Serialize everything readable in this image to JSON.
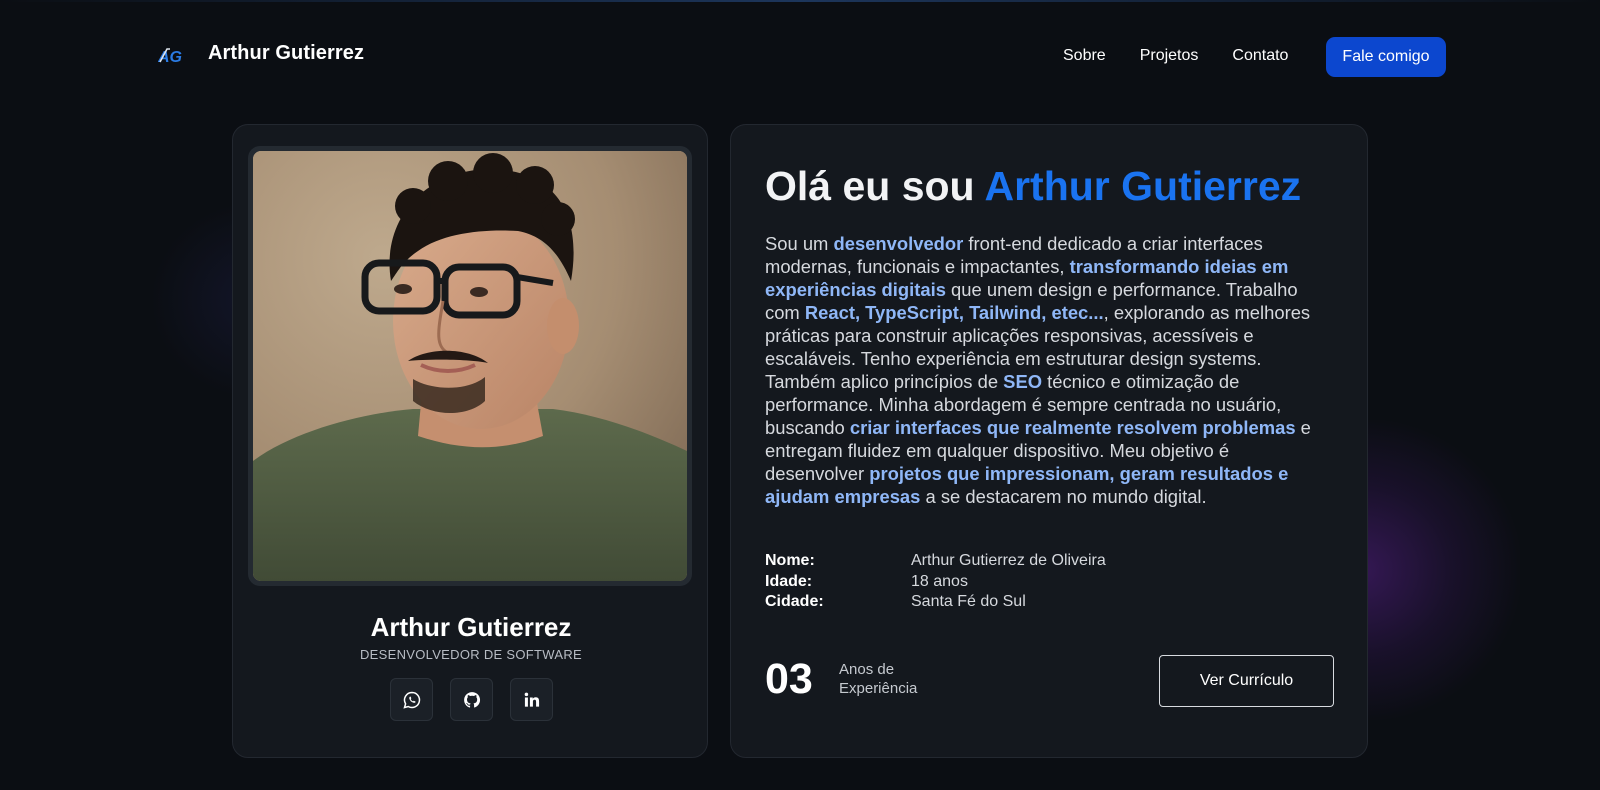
{
  "header": {
    "logo_text": "AG",
    "brand_name": "Arthur Gutierrez",
    "nav": [
      "Sobre",
      "Projetos",
      "Contato"
    ],
    "cta_label": "Fale comigo"
  },
  "profile": {
    "name": "Arthur Gutierrez",
    "role": "DESENVOLVEDOR DE SOFTWARE",
    "socials": [
      {
        "icon": "whatsapp-icon"
      },
      {
        "icon": "github-icon"
      },
      {
        "icon": "linkedin-icon"
      }
    ]
  },
  "about": {
    "greeting": "Olá eu sou ",
    "greeting_name": "Arthur Gutierrez",
    "bio": [
      {
        "t": "Sou um ",
        "b": false
      },
      {
        "t": "desenvolvedor",
        "b": true
      },
      {
        "t": " front-end dedicado a criar interfaces modernas, funcionais e impactantes, ",
        "b": false
      },
      {
        "t": "transformando ideias em experiências digitais",
        "b": true
      },
      {
        "t": " que unem design e performance. Trabalho com ",
        "b": false
      },
      {
        "t": "React, TypeScript, Tailwind, etec...",
        "b": true
      },
      {
        "t": ", explorando as melhores práticas para construir aplicações responsivas, acessíveis e escaláveis. Tenho experiência em estruturar design systems. Também aplico princípios de ",
        "b": false
      },
      {
        "t": "SEO",
        "b": true
      },
      {
        "t": " técnico e otimização de performance. Minha abordagem é sempre centrada no usuário, buscando ",
        "b": false
      },
      {
        "t": "criar interfaces que realmente resolvem problemas",
        "b": true
      },
      {
        "t": " e entregam fluidez em qualquer dispositivo. Meu objetivo é desenvolver ",
        "b": false
      },
      {
        "t": "projetos que impressionam, geram resultados e ajudam empresas",
        "b": true
      },
      {
        "t": " a se destacarem no mundo digital.",
        "b": false
      }
    ],
    "facts": [
      {
        "label": "Nome:",
        "value": "Arthur Gutierrez de Oliveira"
      },
      {
        "label": "Idade:",
        "value": "18 anos"
      },
      {
        "label": "Cidade:",
        "value": "Santa Fé do Sul"
      }
    ],
    "years_value": "03",
    "years_label_line1": "Anos de",
    "years_label_line2": "Experiência",
    "cv_button": "Ver Currículo"
  },
  "colors": {
    "background": "#0b0e13",
    "card": "#14181e",
    "accent": "#1a73f0",
    "highlight": "#8fb7f7",
    "cta": "#0c47cf"
  }
}
